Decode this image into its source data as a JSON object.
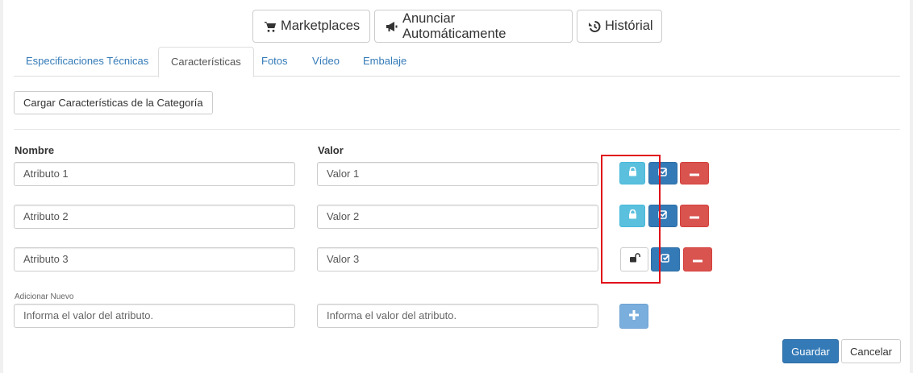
{
  "toolbar": {
    "marketplaces_label": "Marketplaces",
    "anunciar_label": "Anunciar Automáticamente",
    "historial_label": "Histórial"
  },
  "tabs": [
    {
      "label": "Especificaciones Técnicas"
    },
    {
      "label": "Características",
      "active": true
    },
    {
      "label": "Fotos"
    },
    {
      "label": "Vídeo"
    },
    {
      "label": "Embalaje"
    }
  ],
  "load_button": "Cargar Características de la Categoría",
  "columns": {
    "name": "Nombre",
    "value": "Valor"
  },
  "rows": [
    {
      "name": "Atributo 1",
      "value": "Valor 1",
      "locked": true
    },
    {
      "name": "Atributo 2",
      "value": "Valor 2",
      "locked": true
    },
    {
      "name": "Atributo 3",
      "value": "Valor 3",
      "locked": false
    }
  ],
  "add_new": {
    "label": "Adicionar Nuevo",
    "name_placeholder": "Informa el valor del atributo.",
    "value_placeholder": "Informa el valor del atributo."
  },
  "footer": {
    "save_label": "Guardar",
    "cancel_label": "Cancelar"
  },
  "icons": {
    "cart": "shopping-cart-icon",
    "bullhorn": "bullhorn-icon",
    "history": "history-icon",
    "lock": "lock-icon",
    "unlock": "unlock-icon",
    "check": "check-square-icon",
    "minus": "minus-icon",
    "plus": "plus-icon"
  },
  "colors": {
    "primary": "#337ab7",
    "info": "#5bc0de",
    "danger": "#d9534f",
    "highlight": "#e0101a"
  }
}
